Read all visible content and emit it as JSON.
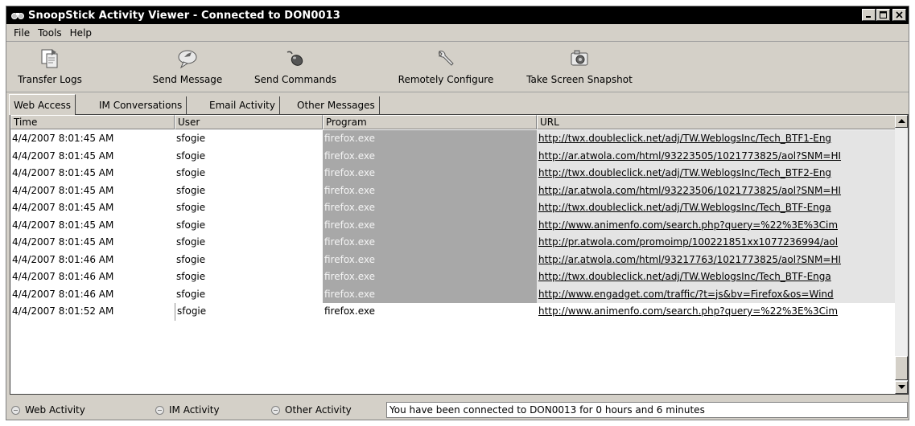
{
  "window": {
    "title": "SnoopStick Activity Viewer - Connected to DON0013"
  },
  "menu": [
    "File",
    "Tools",
    "Help"
  ],
  "toolbar": {
    "transfer_logs": "Transfer Logs",
    "send_message": "Send Message",
    "send_commands": "Send Commands",
    "remotely_configure": "Remotely Configure",
    "take_screen_snapshot": "Take Screen Snapshot"
  },
  "tabs": [
    "Web Access",
    "IM Conversations",
    "Email Activity",
    "Other Messages"
  ],
  "grid": {
    "columns": [
      "Time",
      "User",
      "Program",
      "URL"
    ],
    "rows": [
      [
        "4/4/2007 8:01:45 AM",
        "sfogie",
        "firefox.exe",
        "http://twx.doubleclick.net/adj/TW.WeblogsInc/Tech_BTF1-Eng"
      ],
      [
        "4/4/2007 8:01:45 AM",
        "sfogie",
        "firefox.exe",
        "http://ar.atwola.com/html/93223505/1021773825/aol?SNM=HI"
      ],
      [
        "4/4/2007 8:01:45 AM",
        "sfogie",
        "firefox.exe",
        "http://twx.doubleclick.net/adj/TW.WeblogsInc/Tech_BTF2-Eng"
      ],
      [
        "4/4/2007 8:01:45 AM",
        "sfogie",
        "firefox.exe",
        "http://ar.atwola.com/html/93223506/1021773825/aol?SNM=HI"
      ],
      [
        "4/4/2007 8:01:45 AM",
        "sfogie",
        "firefox.exe",
        "http://twx.doubleclick.net/adj/TW.WeblogsInc/Tech_BTF-Enga"
      ],
      [
        "4/4/2007 8:01:45 AM",
        "sfogie",
        "firefox.exe",
        "http://www.animenfo.com/search.php?query=%22%3E%3Cim"
      ],
      [
        "4/4/2007 8:01:45 AM",
        "sfogie",
        "firefox.exe",
        "http://pr.atwola.com/promoimp/100221851xx1077236994/aol"
      ],
      [
        "4/4/2007 8:01:46 AM",
        "sfogie",
        "firefox.exe",
        "http://ar.atwola.com/html/93217763/1021773825/aol?SNM=HI"
      ],
      [
        "4/4/2007 8:01:46 AM",
        "sfogie",
        "firefox.exe",
        "http://twx.doubleclick.net/adj/TW.WeblogsInc/Tech_BTF-Enga"
      ],
      [
        "4/4/2007 8:01:46 AM",
        "sfogie",
        "firefox.exe",
        "http://www.engadget.com/traffic/?t=js&bv=Firefox&os=Wind"
      ],
      [
        "4/4/2007 8:01:52 AM",
        "sfogie",
        "firefox.exe",
        "http://www.animenfo.com/search.php?query=%22%3E%3Cim"
      ]
    ],
    "selected_row": 10
  },
  "status": {
    "web_activity": "Web Activity",
    "im_activity": "IM Activity",
    "other_activity": "Other Activity",
    "message": "You have been connected to DON0013 for 0 hours and 6 minutes"
  },
  "icons": {
    "app": "binoculars-icon",
    "transfer_logs": "documents-transfer-icon",
    "send_message": "speech-bubble-icon",
    "send_commands": "mouse-icon",
    "remotely_configure": "wrench-icon",
    "take_screen_snapshot": "camera-icon"
  }
}
